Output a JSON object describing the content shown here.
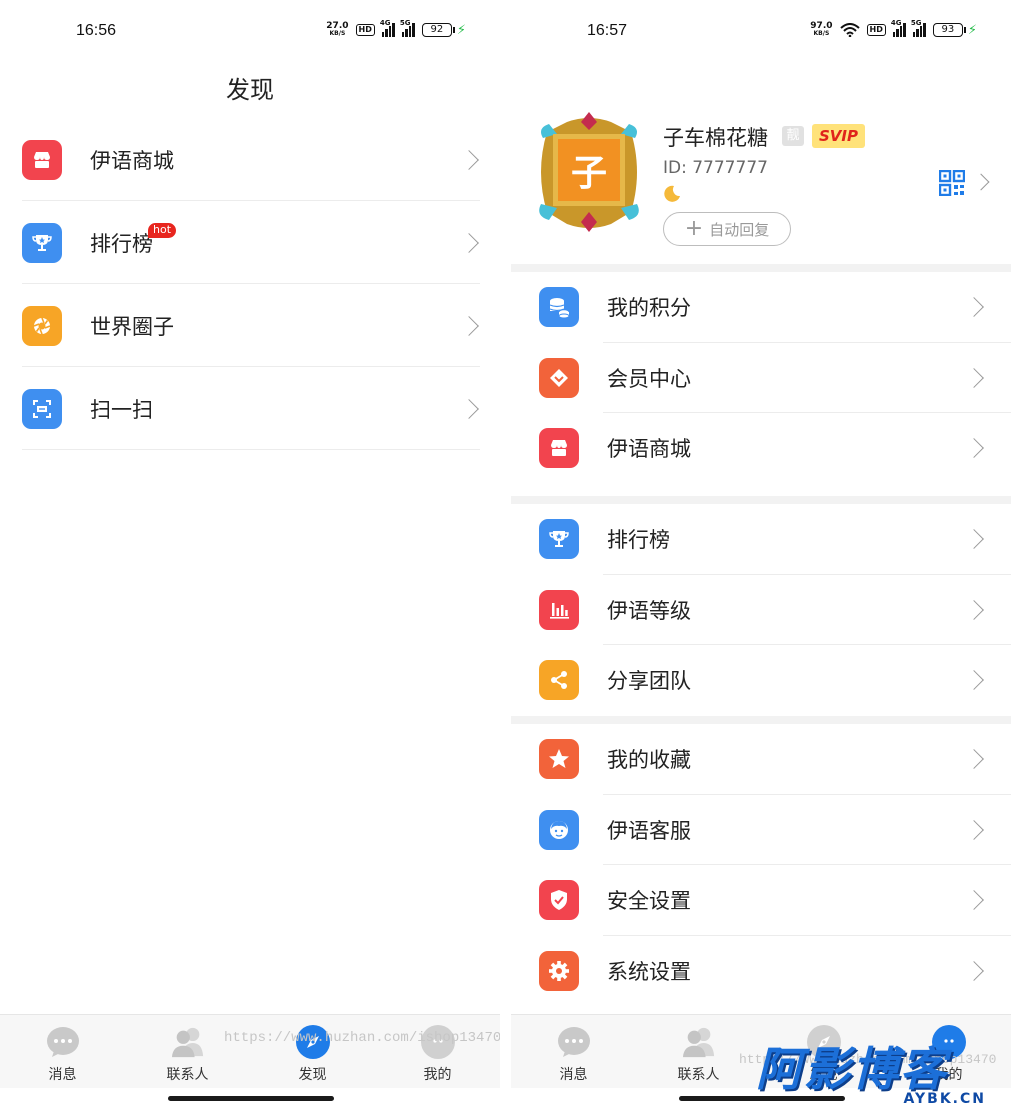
{
  "left": {
    "status": {
      "time": "16:56",
      "speed": "27.0",
      "speed_unit": "KB/S",
      "hd": "HD",
      "net1": "4G",
      "net2": "5G",
      "battery": "92"
    },
    "title": "发现",
    "menu": [
      {
        "label": "伊语商城",
        "icon": "shop-icon",
        "color": "#f2444e"
      },
      {
        "label": "排行榜",
        "icon": "trophy-icon",
        "color": "#3f8ff0",
        "badge": "hot"
      },
      {
        "label": "世界圈子",
        "icon": "aperture-icon",
        "color": "#f7a526"
      },
      {
        "label": "扫一扫",
        "icon": "scan-icon",
        "color": "#3f8ff0"
      }
    ],
    "tabs": [
      {
        "label": "消息",
        "icon": "message-icon"
      },
      {
        "label": "联系人",
        "icon": "contacts-icon"
      },
      {
        "label": "发现",
        "icon": "compass-icon",
        "active": true
      },
      {
        "label": "我的",
        "icon": "profile-icon"
      }
    ],
    "watermark": "https://www.huzhan.com/ishop13470"
  },
  "right": {
    "status": {
      "time": "16:57",
      "speed": "97.0",
      "speed_unit": "KB/S",
      "hd": "HD",
      "net1": "4G",
      "net2": "5G",
      "battery": "93"
    },
    "profile": {
      "avatar_char": "子",
      "nickname": "子车棉花糖",
      "liang": "靓",
      "svip": "SVIP",
      "id": "ID: 7777777",
      "auto_reply": "自动回复"
    },
    "groups": [
      [
        {
          "label": "我的积分",
          "icon": "coins-icon",
          "color": "#3f8ff0"
        },
        {
          "label": "会员中心",
          "icon": "vip-diamond-icon",
          "color": "#f2633a"
        },
        {
          "label": "伊语商城",
          "icon": "shop-icon",
          "color": "#f2444e"
        }
      ],
      [
        {
          "label": "排行榜",
          "icon": "trophy-icon",
          "color": "#3f8ff0"
        },
        {
          "label": "伊语等级",
          "icon": "bar-chart-icon",
          "color": "#f2444e"
        },
        {
          "label": "分享团队",
          "icon": "share-icon",
          "color": "#f7a526"
        }
      ],
      [
        {
          "label": "我的收藏",
          "icon": "star-icon",
          "color": "#f2633a"
        },
        {
          "label": "伊语客服",
          "icon": "customer-service-icon",
          "color": "#3f8ff0"
        },
        {
          "label": "安全设置",
          "icon": "shield-icon",
          "color": "#f2444e"
        },
        {
          "label": "系统设置",
          "icon": "gear-icon",
          "color": "#f2633a"
        }
      ]
    ],
    "tabs": [
      {
        "label": "消息",
        "icon": "message-icon"
      },
      {
        "label": "联系人",
        "icon": "contacts-icon"
      },
      {
        "label": "发现",
        "icon": "compass-icon"
      },
      {
        "label": "我的",
        "icon": "profile-icon",
        "active": true
      }
    ],
    "watermark": "https://www.huzhan.com/ishop13470",
    "brand_cn": "阿影博客",
    "brand_en": "AYBK.CN"
  }
}
